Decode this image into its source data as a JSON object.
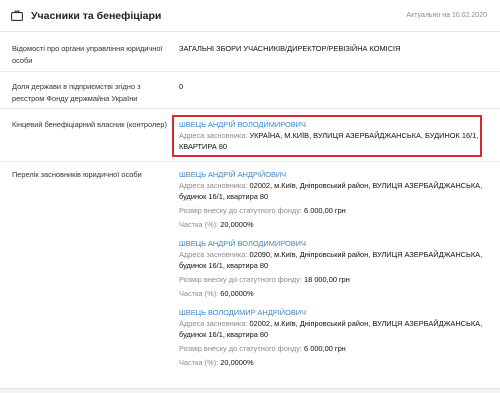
{
  "header": {
    "title": "Учасники та бенефіціари",
    "date": "Актуально на 10.02.2020"
  },
  "management": {
    "label": "Відомості про органи управління юридичної особи",
    "value": "ЗАГАЛЬНІ ЗБОРИ УЧАСНИКІВ/ДИРЕКТОР/РЕВІЗІЙНА КОМІСІЯ"
  },
  "state_share": {
    "label": "Доля держави в підприємстві згідно з реєстром Фонду держмайна України",
    "value": "0"
  },
  "beneficiary": {
    "label": "Кінцевий бенефіціарний власник (контролер)",
    "name": "ШВЕЦЬ АНДРІЙ ВОЛОДИМИРОВИЧ",
    "address_key": "Адреса засновника:",
    "address_value": "УКРАЇНА, М.КИЇВ, ВУЛИЦЯ АЗЕРБАЙДЖАНСЬКА, БУДИНОК 16/1, КВАРТИРА 80"
  },
  "founders": {
    "label": "Перелік засновників юридичної особи",
    "items": [
      {
        "name": "ШВЕЦЬ АНДРІЙ АНДРІЙОВИЧ",
        "address_key": "Адреса засновника:",
        "address_value": "02002, м.Київ, Дніпровський район, ВУЛИЦЯ АЗЕРБАЙДЖАНСЬКА, будинок 16/1, квартира 80",
        "capital_key": "Розмір внеску до статутного фонду:",
        "capital_value": "6 000,00 грн",
        "share_key": "Частка (%):",
        "share_value": "20,0000%"
      },
      {
        "name": "ШВЕЦЬ АНДРІЙ ВОЛОДИМИРОВИЧ",
        "address_key": "Адреса засновника:",
        "address_value": "02090, м.Київ, Дніпровський район, ВУЛИЦЯ АЗЕРБАЙДЖАНСЬКА, будинок 16/1, квартира 80",
        "capital_key": "Розмір внеску до статутного фонду:",
        "capital_value": "18 000,00 грн",
        "share_key": "Частка (%):",
        "share_value": "60,0000%"
      },
      {
        "name": "ШВЕЦЬ ВОЛОДИМИР АНДРІЙОВИЧ",
        "address_key": "Адреса засновника:",
        "address_value": "02002, м.Київ, Дніпровський район, ВУЛИЦЯ АЗЕРБАЙДЖАНСЬКА, будинок 16/1, квартира 80",
        "capital_key": "Розмір внеску до статутного фонду:",
        "capital_value": "6 000,00 грн",
        "share_key": "Частка (%):",
        "share_value": "20,0000%"
      }
    ]
  },
  "colors": {
    "link": "#3a86c8",
    "highlight": "#d6292b"
  },
  "icons": {
    "header": "briefcase-icon"
  }
}
